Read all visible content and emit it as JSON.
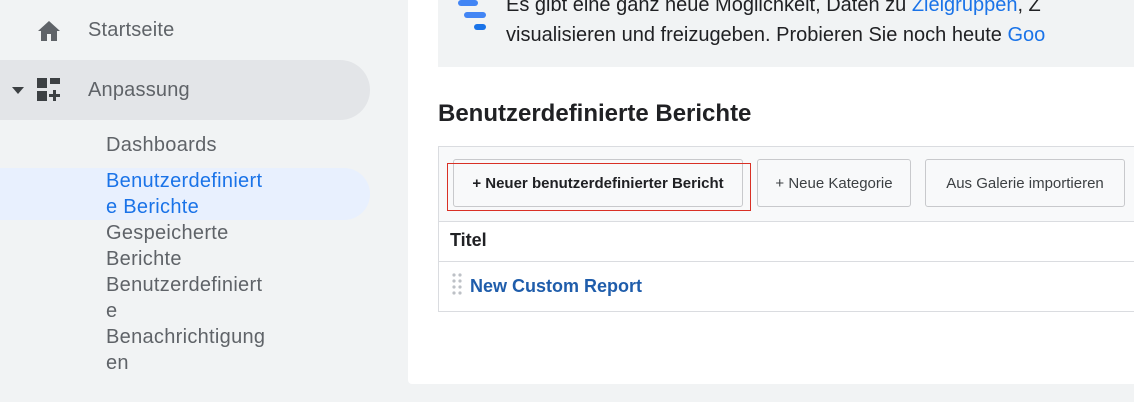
{
  "sidebar": {
    "home": {
      "label": "Startseite",
      "icon": "home-icon"
    },
    "customization": {
      "label": "Anpassung",
      "icon": "dashboard-add-icon",
      "expanded": true
    },
    "subitems": [
      {
        "label": "Dashboards",
        "active": false
      },
      {
        "label": "Benutzerdefiniert\ne Berichte",
        "active": true
      },
      {
        "label": "Gespeicherte\nBerichte",
        "active": false
      },
      {
        "label": "Benutzerdefiniert\ne\nBenachrichtigung\nen",
        "active": false
      }
    ]
  },
  "banner": {
    "line1_prefix": "Es gibt eine ganz neue Möglichkeit, Daten zu ",
    "line1_link": "Zielgruppen",
    "line1_suffix": ", Z",
    "line2_prefix": "visualisieren und freizugeben. Probieren Sie noch heute ",
    "line2_link": "Goo"
  },
  "main": {
    "title": "Benutzerdefinierte Berichte",
    "buttons": {
      "new_report": "+ Neuer benutzerdefinierter Bericht",
      "new_category": "+ Neue Kategorie",
      "import_gallery": "Aus Galerie importieren"
    },
    "table": {
      "column_title": "Titel",
      "rows": [
        {
          "title": "New Custom Report"
        }
      ]
    }
  },
  "colors": {
    "accent": "#1a73e8",
    "link": "#1f5dab",
    "highlight": "#d93025",
    "active_bg": "#e8f0fe"
  }
}
